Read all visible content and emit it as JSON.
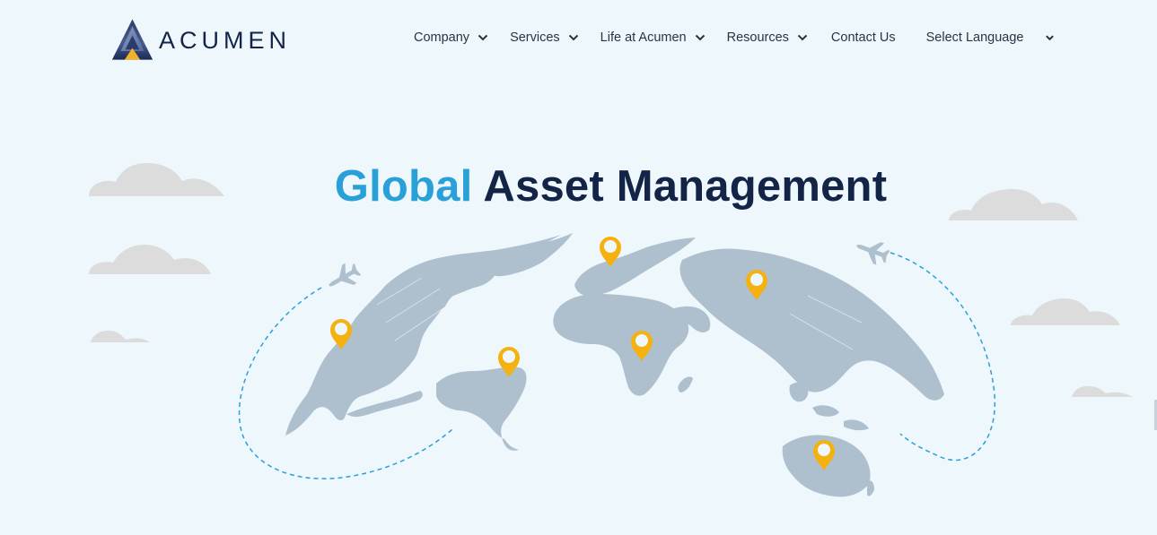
{
  "brand": {
    "name": "ACUMEN"
  },
  "nav": {
    "items": [
      {
        "label": "Company",
        "dropdown": true
      },
      {
        "label": "Services",
        "dropdown": true
      },
      {
        "label": "Life at Acumen",
        "dropdown": true
      },
      {
        "label": "Resources",
        "dropdown": true
      },
      {
        "label": "Contact Us",
        "dropdown": false
      }
    ],
    "language": {
      "label": "Select Language"
    }
  },
  "hero": {
    "title_accent": "Global",
    "title_rest": " Asset Management"
  },
  "colors": {
    "background": "#eef8fc",
    "accent": "#2aa0d8",
    "navy": "#132447",
    "map": "#aebfce",
    "pin": "#f5b10f",
    "cloud": "#dcdcdc",
    "route": "#2aa0d8"
  },
  "icons": {
    "pins": [
      "location-pin-icon",
      "location-pin-icon",
      "location-pin-icon",
      "location-pin-icon",
      "location-pin-icon",
      "location-pin-icon"
    ],
    "planes": [
      "airplane-icon",
      "airplane-icon"
    ],
    "nav_chevron": "chevron-down-icon"
  }
}
